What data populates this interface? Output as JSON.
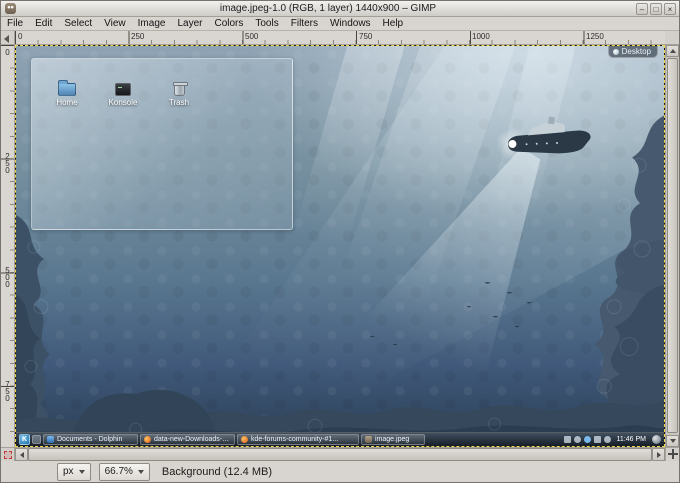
{
  "titlebar": {
    "title": "image.jpeg-1.0 (RGB, 1 layer) 1440x900 – GIMP",
    "minimize_glyph": "–",
    "maximize_glyph": "□",
    "close_glyph": "×"
  },
  "menubar": {
    "items": [
      "File",
      "Edit",
      "Select",
      "View",
      "Image",
      "Layer",
      "Colors",
      "Tools",
      "Filters",
      "Windows",
      "Help"
    ]
  },
  "rulers": {
    "horizontal_marks": [
      "0",
      "250",
      "500",
      "750",
      "1000",
      "1250"
    ],
    "vertical_marks": [
      "0",
      "250",
      "500",
      "750"
    ]
  },
  "statusbar": {
    "unit_selector": "px",
    "zoom_level": "66.7%",
    "status_text": "Background (12.4 MB)"
  },
  "canvas": {
    "desktop_toolbox_label": "Desktop",
    "folderview_icons": [
      {
        "label": "Home"
      },
      {
        "label": "Konsole"
      },
      {
        "label": "Trash"
      }
    ],
    "taskbar": {
      "window_buttons": [
        {
          "label": "Documents - Dolphin"
        },
        {
          "label": "data-new-Downloads-...jpeg"
        },
        {
          "label": "kde-forums-community-#1..."
        },
        {
          "label": "image.jpeg"
        }
      ],
      "clock": "11:46 PM"
    }
  },
  "colors": {
    "layer_boundary_yellow": "#f0d84a",
    "chrome_gray": "#d8d4cf",
    "sea_top": "#8fa3b4",
    "sea_bottom": "#2b3f55",
    "taskbar_dark": "#1c2836"
  }
}
